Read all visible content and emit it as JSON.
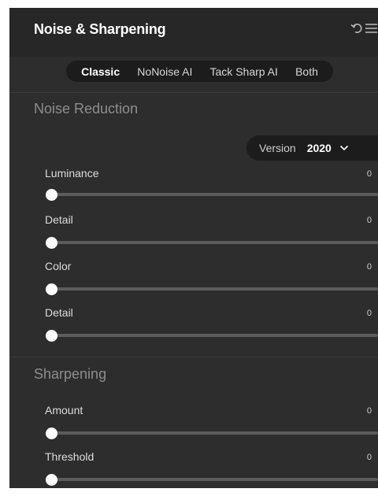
{
  "panel": {
    "title": "Noise & Sharpening"
  },
  "tabs": [
    "Classic",
    "NoNoise AI",
    "Tack Sharp AI",
    "Both"
  ],
  "active_tab": "Classic",
  "noise_reduction": {
    "title": "Noise Reduction",
    "version_label": "Version",
    "version_value": "2020",
    "sliders": [
      {
        "label": "Luminance",
        "value": "0"
      },
      {
        "label": "Detail",
        "value": "0"
      },
      {
        "label": "Color",
        "value": "0"
      },
      {
        "label": "Detail",
        "value": "0"
      }
    ]
  },
  "sharpening": {
    "title": "Sharpening",
    "sliders": [
      {
        "label": "Amount",
        "value": "0"
      },
      {
        "label": "Threshold",
        "value": "0"
      }
    ]
  },
  "icons": {
    "undo": "undo-icon",
    "menu": "menu-icon",
    "chevron": "chevron-down-icon"
  },
  "colors": {
    "panel_bg": "#2d2d2d",
    "header_bg": "#272727",
    "pill_bg": "#1c1c1c",
    "section_title": "#8d8d8d",
    "track": "#5c5c5c",
    "thumb": "#ffffff"
  }
}
